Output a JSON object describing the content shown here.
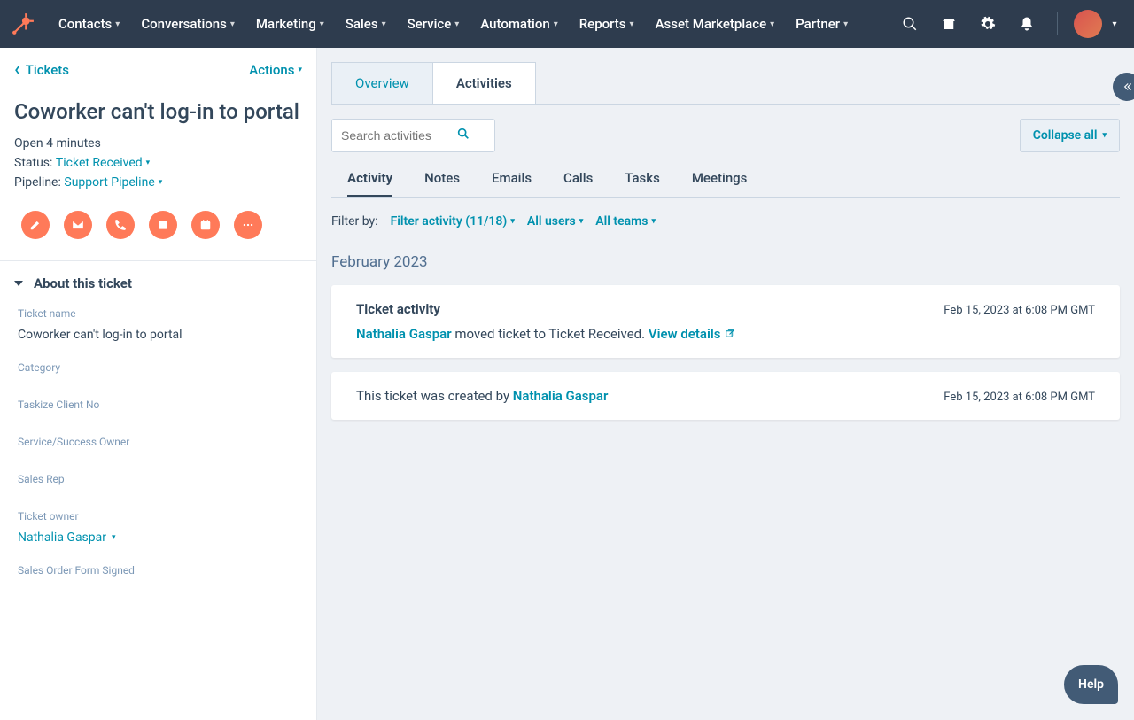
{
  "nav": {
    "items": [
      "Contacts",
      "Conversations",
      "Marketing",
      "Sales",
      "Service",
      "Automation",
      "Reports",
      "Asset Marketplace",
      "Partner"
    ]
  },
  "left": {
    "back": "Tickets",
    "actions": "Actions",
    "title": "Coworker can't log-in to portal",
    "open_line": "Open 4 minutes",
    "status_label": "Status:",
    "status_value": "Ticket Received",
    "pipeline_label": "Pipeline:",
    "pipeline_value": "Support Pipeline",
    "about_title": "About this ticket",
    "fields": {
      "ticket_name_label": "Ticket name",
      "ticket_name_value": "Coworker can't log-in to portal",
      "category_label": "Category",
      "taskize_label": "Taskize Client No",
      "owner_service_label": "Service/Success Owner",
      "sales_rep_label": "Sales Rep",
      "ticket_owner_label": "Ticket owner",
      "ticket_owner_value": "Nathalia Gaspar",
      "sales_order_label": "Sales Order Form Signed"
    }
  },
  "right": {
    "tabs": {
      "overview": "Overview",
      "activities": "Activities"
    },
    "search_placeholder": "Search activities",
    "collapse": "Collapse all",
    "sub_tabs": [
      "Activity",
      "Notes",
      "Emails",
      "Calls",
      "Tasks",
      "Meetings"
    ],
    "filter_label": "Filter by:",
    "filters": {
      "activity": "Filter activity (11/18)",
      "users": "All users",
      "teams": "All teams"
    },
    "month": "February 2023",
    "card1": {
      "title": "Ticket activity",
      "time": "Feb 15, 2023 at 6:08 PM GMT",
      "user": "Nathalia Gaspar",
      "text": " moved ticket to Ticket Received. ",
      "view": "View details"
    },
    "card2": {
      "text": "This ticket was created by ",
      "user": "Nathalia Gaspar",
      "time": "Feb 15, 2023 at 6:08 PM GMT"
    },
    "help": "Help"
  }
}
